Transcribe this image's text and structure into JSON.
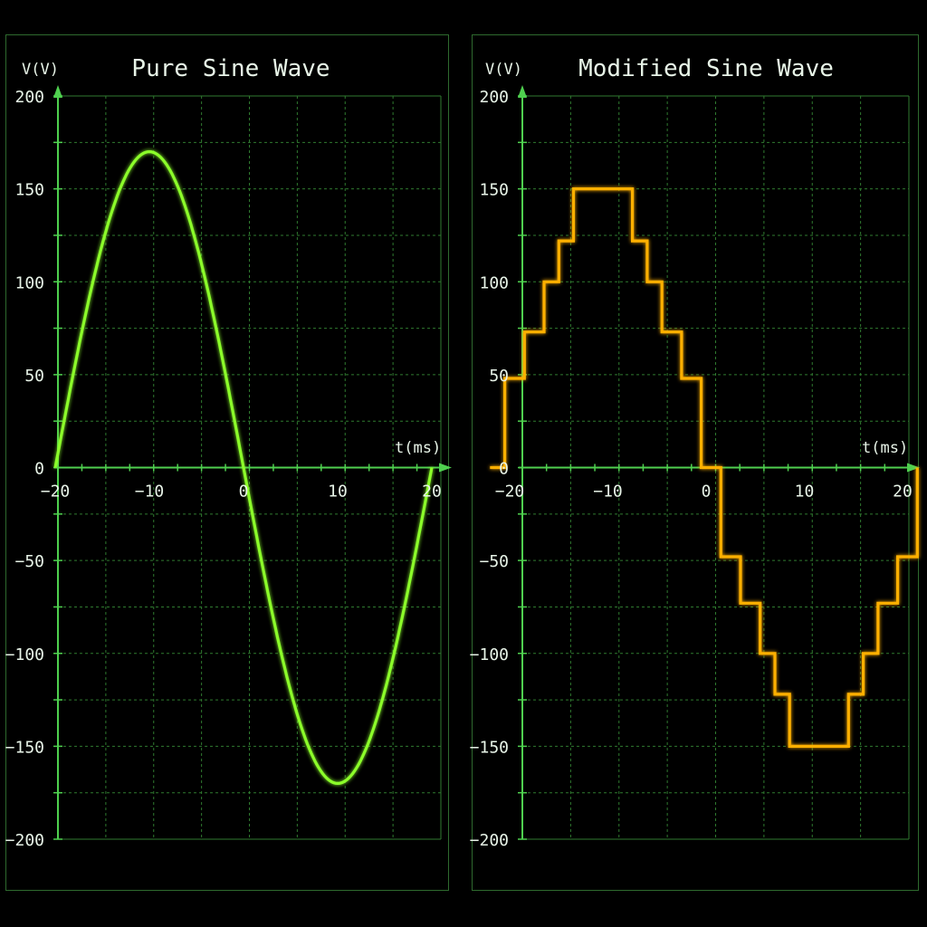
{
  "colors": {
    "background": "#000000",
    "grid": "#2f7a2f",
    "axis": "#4fd04f",
    "pure_trace": "#8cff2a",
    "modified_trace": "#ffb000",
    "text": "#e8f4e8"
  },
  "chart_data": [
    {
      "type": "line",
      "title": "Pure Sine Wave",
      "xlabel": "t(ms)",
      "ylabel": "V(V)",
      "xlim": [
        -20,
        20
      ],
      "ylim": [
        -200,
        200
      ],
      "x_ticks": [
        -20,
        -10,
        0,
        10,
        20
      ],
      "y_ticks": [
        200,
        150,
        100,
        50,
        0,
        -50,
        -100,
        -150,
        -200
      ],
      "x_tick_labels": [
        "−20",
        "−10",
        "0",
        "10",
        "20"
      ],
      "y_tick_labels": [
        "200",
        "150",
        "100",
        "50",
        "0",
        "−50",
        "−100",
        "−150",
        "−200"
      ],
      "grid": true,
      "series": [
        {
          "color": "#8cff2a",
          "function": "sine",
          "amplitude": 170,
          "period_ms": 40,
          "x": [
            -20.0,
            -17.5,
            -15.0,
            -12.5,
            -10.0,
            -7.5,
            -5.0,
            -2.5,
            0.0,
            2.5,
            5.0,
            7.5,
            10.0,
            12.5,
            15.0,
            17.5,
            20.0
          ],
          "y": [
            0,
            65,
            120,
            157,
            170,
            157,
            120,
            65,
            0,
            -65,
            -120,
            -157,
            -170,
            -157,
            -120,
            -65,
            0
          ]
        }
      ]
    },
    {
      "type": "line",
      "title": "Modified Sine Wave",
      "xlabel": "t(ms)",
      "ylabel": "V(V)",
      "xlim": [
        -20,
        20
      ],
      "ylim": [
        -200,
        200
      ],
      "x_ticks": [
        -20,
        -10,
        0,
        10,
        20
      ],
      "y_ticks": [
        200,
        150,
        100,
        50,
        0,
        -50,
        -100,
        -150,
        -200
      ],
      "x_tick_labels": [
        "−20",
        "−10",
        "0",
        "10",
        "20"
      ],
      "y_tick_labels": [
        "200",
        "150",
        "100",
        "50",
        "0",
        "−50",
        "−100",
        "−150",
        "−200"
      ],
      "grid": true,
      "series": [
        {
          "color": "#ffb000",
          "step": true,
          "x": [
            -22,
            -20.5,
            -20.5,
            -18.5,
            -18.5,
            -16.5,
            -16.5,
            -15.0,
            -15.0,
            -13.5,
            -13.5,
            -7.5,
            -7.5,
            -6.0,
            -6.0,
            -4.5,
            -4.5,
            -2.5,
            -2.5,
            -0.5,
            -0.5,
            1.5,
            1.5,
            3.5,
            3.5,
            5.5,
            5.5,
            7.0,
            7.0,
            8.5,
            8.5,
            14.5,
            14.5,
            16.0,
            16.0,
            17.5,
            17.5,
            19.5,
            19.5,
            21.5,
            21.5
          ],
          "y": [
            0,
            0,
            48,
            48,
            73,
            73,
            100,
            100,
            122,
            122,
            150,
            150,
            122,
            122,
            100,
            100,
            73,
            73,
            48,
            48,
            0,
            0,
            -48,
            -48,
            -73,
            -73,
            -100,
            -100,
            -122,
            -122,
            -150,
            -150,
            -122,
            -122,
            -100,
            -100,
            -73,
            -73,
            -48,
            -48,
            0
          ]
        }
      ]
    }
  ]
}
